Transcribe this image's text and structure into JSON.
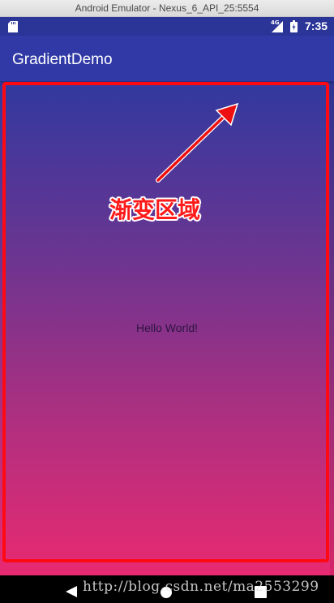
{
  "window": {
    "title": "Android Emulator - Nexus_6_API_25:5554"
  },
  "status_bar": {
    "network_type": "4G",
    "time": "7:35",
    "icons": [
      "sd-card-icon",
      "signal-icon",
      "battery-icon"
    ]
  },
  "app_bar": {
    "title": "GradientDemo"
  },
  "content": {
    "text": "Hello World!",
    "gradient_colors": [
      "#31399f",
      "#6a3591",
      "#b12f7f",
      "#e82a71"
    ]
  },
  "annotation": {
    "label": "渐变区域",
    "color": "#ff0a14"
  },
  "nav_bar": {
    "icons": [
      "back-icon",
      "home-icon",
      "recents-icon"
    ]
  },
  "watermark": {
    "text": "http://blog.csdn.net/ma2553299"
  }
}
